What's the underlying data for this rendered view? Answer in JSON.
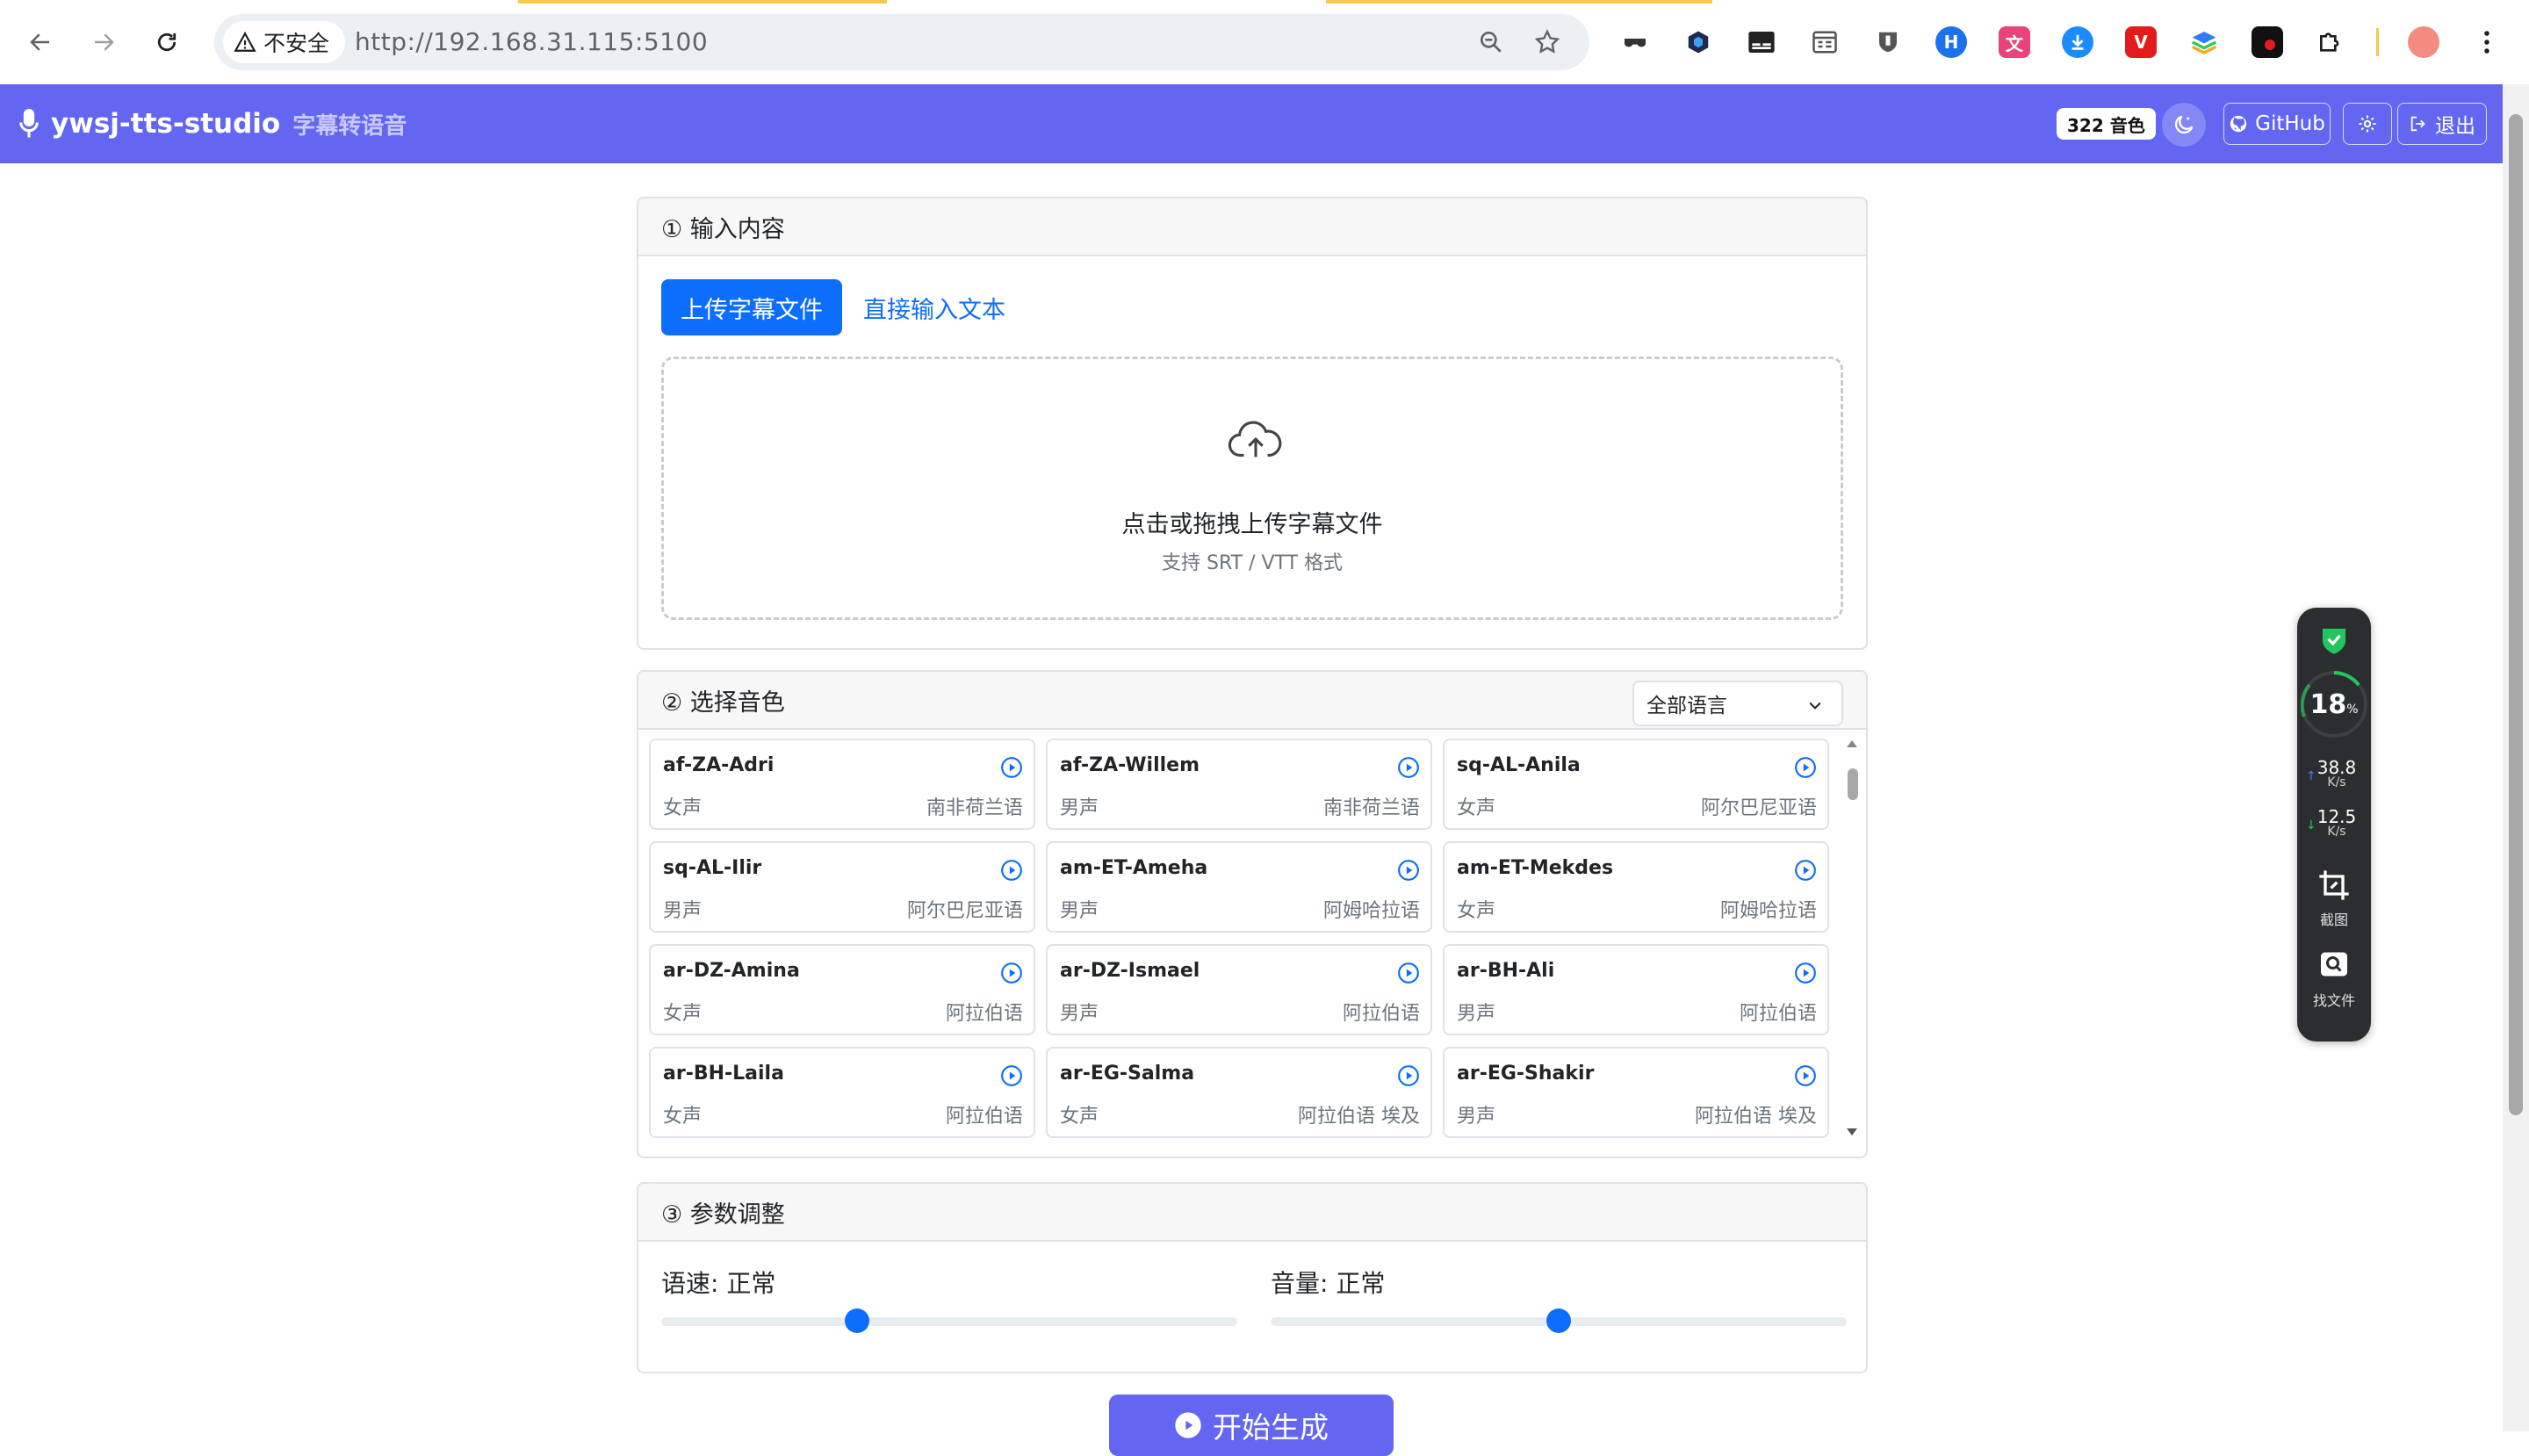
{
  "browser": {
    "security_label": "不安全",
    "url": "http://192.168.31.115:5100"
  },
  "app": {
    "name": "ywsj-tts-studio",
    "subtitle": "字幕转语音",
    "voice_count": "322 音色",
    "github_label": "GitHub",
    "logout_label": "退出",
    "accent_color": "#6366f1"
  },
  "input_section": {
    "title": "① 输入内容",
    "tab_upload": "上传字幕文件",
    "tab_text": "直接输入文本",
    "drop_title": "点击或拖拽上传字幕文件",
    "drop_hint": "支持 SRT / VTT 格式"
  },
  "voice_section": {
    "title": "② 选择音色",
    "language_filter": "全部语言",
    "voices": [
      {
        "name": "af-ZA-Adri",
        "gender": "女声",
        "language": "南非荷兰语"
      },
      {
        "name": "af-ZA-Willem",
        "gender": "男声",
        "language": "南非荷兰语"
      },
      {
        "name": "sq-AL-Anila",
        "gender": "女声",
        "language": "阿尔巴尼亚语"
      },
      {
        "name": "sq-AL-Ilir",
        "gender": "男声",
        "language": "阿尔巴尼亚语"
      },
      {
        "name": "am-ET-Ameha",
        "gender": "男声",
        "language": "阿姆哈拉语"
      },
      {
        "name": "am-ET-Mekdes",
        "gender": "女声",
        "language": "阿姆哈拉语"
      },
      {
        "name": "ar-DZ-Amina",
        "gender": "女声",
        "language": "阿拉伯语"
      },
      {
        "name": "ar-DZ-Ismael",
        "gender": "男声",
        "language": "阿拉伯语"
      },
      {
        "name": "ar-BH-Ali",
        "gender": "男声",
        "language": "阿拉伯语"
      },
      {
        "name": "ar-BH-Laila",
        "gender": "女声",
        "language": "阿拉伯语"
      },
      {
        "name": "ar-EG-Salma",
        "gender": "女声",
        "language": "阿拉伯语 埃及"
      },
      {
        "name": "ar-EG-Shakir",
        "gender": "男声",
        "language": "阿拉伯语 埃及"
      }
    ]
  },
  "params_section": {
    "title": "③ 参数调整",
    "rate_label": "语速: 正常",
    "volume_label": "音量: 正常",
    "rate_value": 0.34,
    "volume_value": 0.5
  },
  "generate_label": "开始生成",
  "monitor": {
    "cpu_percent": "18",
    "cpu_unit": "%",
    "upload_speed": "38.8",
    "download_speed": "12.5",
    "speed_unit": "K/s",
    "screenshot_label": "截图",
    "find_file_label": "找文件"
  }
}
